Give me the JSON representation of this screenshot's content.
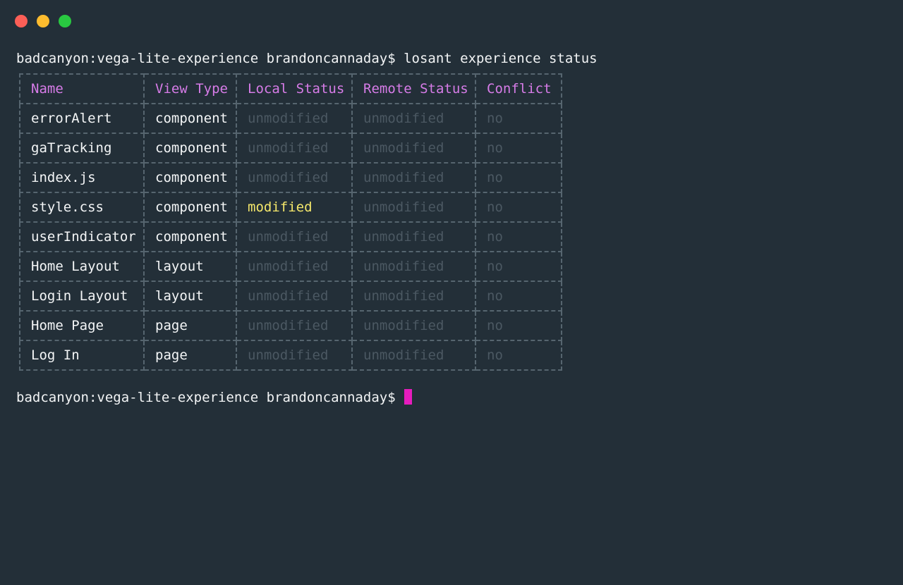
{
  "window": {
    "controls": [
      "close",
      "minimize",
      "zoom"
    ],
    "colors": {
      "close": "#fc5f57",
      "minimize": "#fdbc2e",
      "zoom": "#29c941",
      "background": "#232f38",
      "header": "#d77ce8",
      "modified": "#f4e76b",
      "cursor": "#e61cbd"
    }
  },
  "terminal": {
    "prompt": "badcanyon:vega-lite-experience brandoncannaday$",
    "command": "losant experience status",
    "line1": "badcanyon:vega-lite-experience brandoncannaday$ losant experience status",
    "line2": "badcanyon:vega-lite-experience brandoncannaday$"
  },
  "table": {
    "headers": [
      "Name",
      "View Type",
      "Local Status",
      "Remote Status",
      "Conflict"
    ],
    "rows": [
      [
        "errorAlert",
        "component",
        "unmodified",
        "unmodified",
        "no"
      ],
      [
        "gaTracking",
        "component",
        "unmodified",
        "unmodified",
        "no"
      ],
      [
        "index.js",
        "component",
        "unmodified",
        "unmodified",
        "no"
      ],
      [
        "style.css",
        "component",
        "modified",
        "unmodified",
        "no"
      ],
      [
        "userIndicator",
        "component",
        "unmodified",
        "unmodified",
        "no"
      ],
      [
        "Home Layout",
        "layout",
        "unmodified",
        "unmodified",
        "no"
      ],
      [
        "Login Layout",
        "layout",
        "unmodified",
        "unmodified",
        "no"
      ],
      [
        "Home Page",
        "page",
        "unmodified",
        "unmodified",
        "no"
      ],
      [
        "Log In",
        "page",
        "unmodified",
        "unmodified",
        "no"
      ]
    ]
  }
}
